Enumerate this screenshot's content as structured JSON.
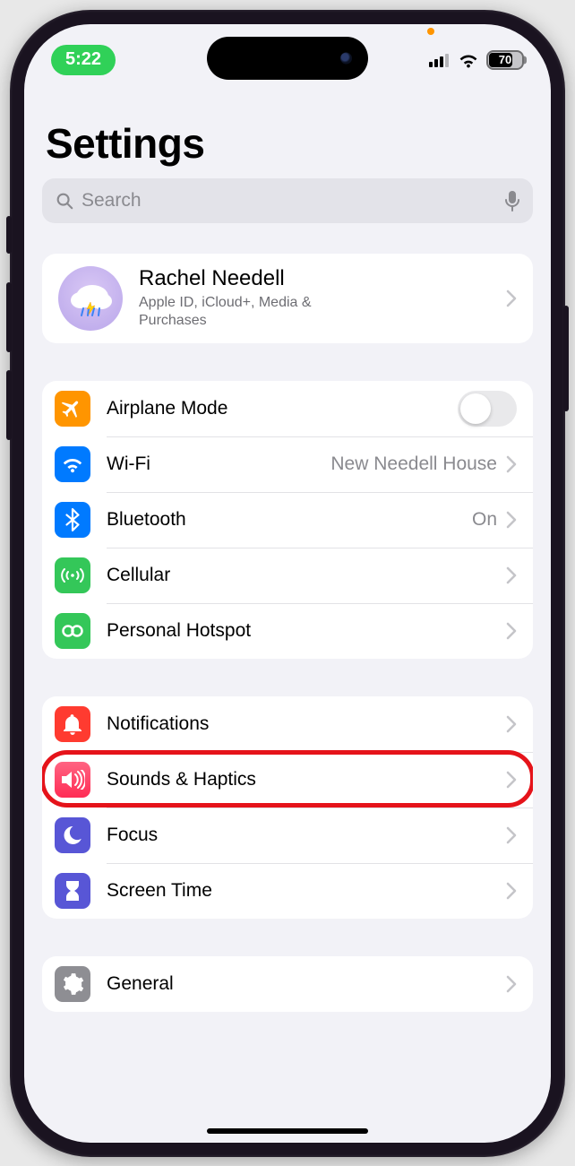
{
  "status": {
    "time": "5:22",
    "battery": "70"
  },
  "title": "Settings",
  "search": {
    "placeholder": "Search"
  },
  "profile": {
    "name": "Rachel Needell",
    "subtitle": "Apple ID, iCloud+, Media & Purchases"
  },
  "group1": {
    "airplane": {
      "label": "Airplane Mode"
    },
    "wifi": {
      "label": "Wi-Fi",
      "value": "New Needell House"
    },
    "bluetooth": {
      "label": "Bluetooth",
      "value": "On"
    },
    "cellular": {
      "label": "Cellular"
    },
    "hotspot": {
      "label": "Personal Hotspot"
    }
  },
  "group2": {
    "notifications": {
      "label": "Notifications"
    },
    "sounds": {
      "label": "Sounds & Haptics"
    },
    "focus": {
      "label": "Focus"
    },
    "screentime": {
      "label": "Screen Time"
    }
  },
  "group3": {
    "general": {
      "label": "General"
    }
  }
}
